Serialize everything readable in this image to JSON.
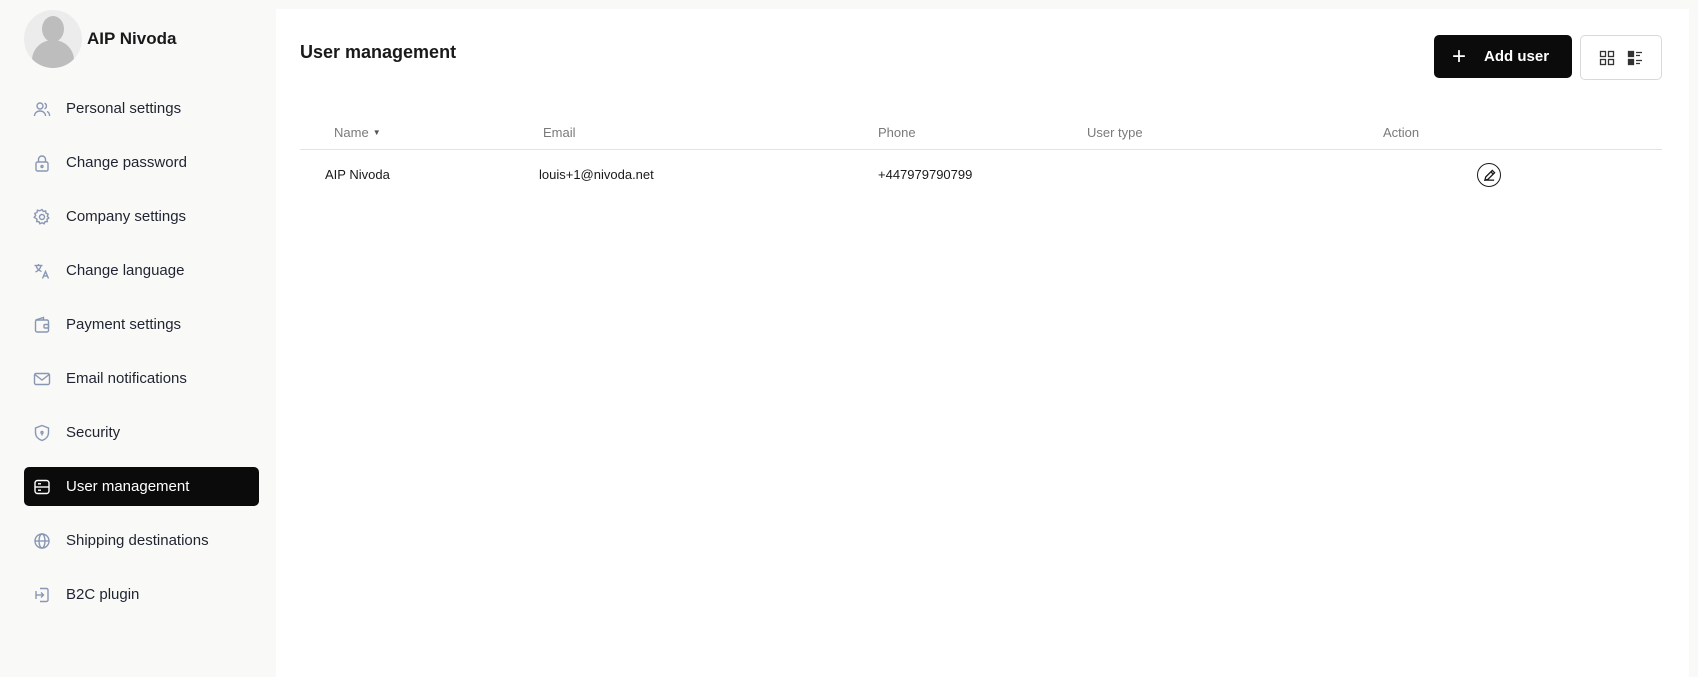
{
  "profile": {
    "name": "AIP Nivoda"
  },
  "sidebar": {
    "items": [
      {
        "label": "Personal settings",
        "icon": "users-icon"
      },
      {
        "label": "Change password",
        "icon": "lock-icon"
      },
      {
        "label": "Company settings",
        "icon": "gear-icon"
      },
      {
        "label": "Change language",
        "icon": "translate-icon"
      },
      {
        "label": "Payment settings",
        "icon": "wallet-icon"
      },
      {
        "label": "Email notifications",
        "icon": "mail-icon"
      },
      {
        "label": "Security",
        "icon": "shield-icon"
      },
      {
        "label": "User management",
        "icon": "server-icon",
        "active": true
      },
      {
        "label": "Shipping destinations",
        "icon": "globe-icon"
      },
      {
        "label": "B2C plugin",
        "icon": "plugin-icon"
      }
    ]
  },
  "main": {
    "title": "User management",
    "add_user_label": "Add user",
    "table": {
      "columns": [
        "Name",
        "Email",
        "Phone",
        "User type",
        "Action"
      ],
      "rows": [
        {
          "name": "AIP Nivoda",
          "email": "louis+1@nivoda.net",
          "phone": "+447979790799",
          "user_type": ""
        }
      ]
    }
  },
  "colors": {
    "accent": "#0b0b0b",
    "icon": "#8a97b3"
  }
}
